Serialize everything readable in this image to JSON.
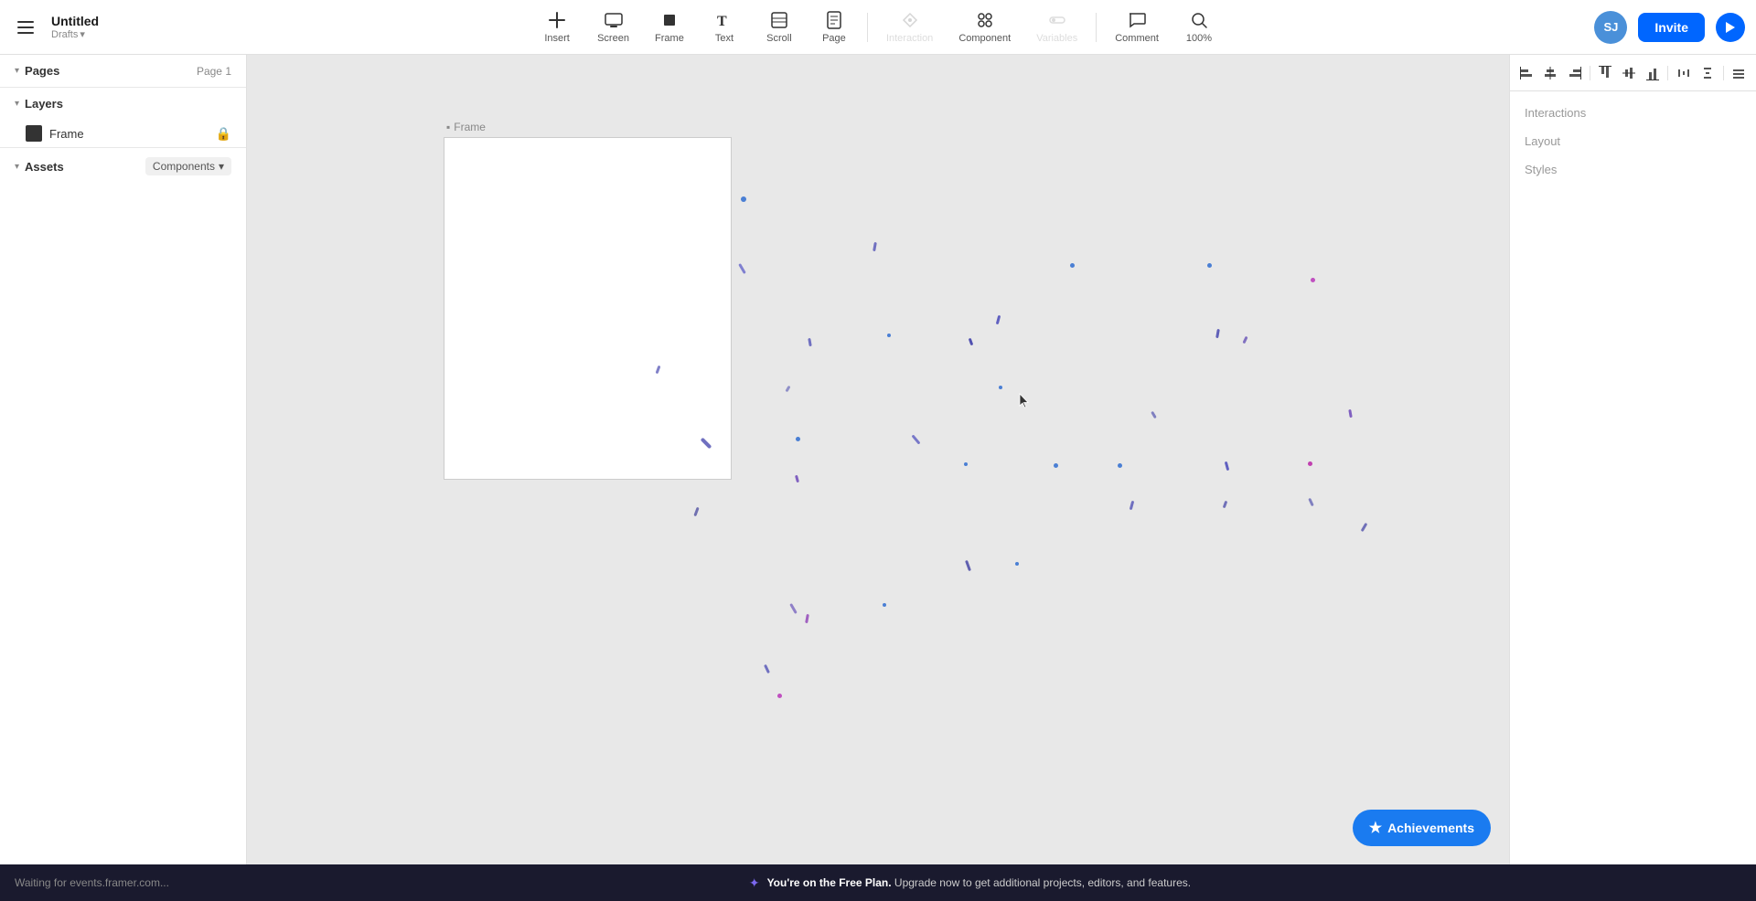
{
  "toolbar": {
    "hamburger_label": "menu",
    "project_title": "Untitled",
    "project_sub": "Drafts",
    "tools": [
      {
        "id": "insert",
        "label": "Insert",
        "icon": "+",
        "disabled": false
      },
      {
        "id": "screen",
        "label": "Screen",
        "icon": "screen",
        "disabled": false
      },
      {
        "id": "frame",
        "label": "Frame",
        "icon": "frame",
        "disabled": false
      },
      {
        "id": "text",
        "label": "Text",
        "icon": "text",
        "disabled": false
      },
      {
        "id": "scroll",
        "label": "Scroll",
        "icon": "scroll",
        "disabled": false
      },
      {
        "id": "page",
        "label": "Page",
        "icon": "page",
        "disabled": false
      },
      {
        "id": "interaction",
        "label": "Interaction",
        "icon": "interaction",
        "disabled": true
      },
      {
        "id": "component",
        "label": "Component",
        "icon": "component",
        "disabled": false
      },
      {
        "id": "variables",
        "label": "Variables",
        "icon": "variables",
        "disabled": true
      },
      {
        "id": "comment",
        "label": "Comment",
        "icon": "comment",
        "disabled": false
      },
      {
        "id": "zoom",
        "label": "100%",
        "icon": "zoom",
        "disabled": false
      }
    ],
    "avatar_initials": "SJ",
    "invite_label": "Invite"
  },
  "left_sidebar": {
    "pages_section": {
      "title": "Pages",
      "page_label": "Page 1"
    },
    "layers_section": {
      "title": "Layers",
      "items": [
        {
          "id": "frame-layer",
          "label": "Frame",
          "locked": true
        }
      ]
    },
    "assets_section": {
      "title": "Assets",
      "dropdown_label": "Components",
      "dropdown_icon": "▾"
    }
  },
  "canvas": {
    "frame_label": "Frame",
    "frame_icon": "▪"
  },
  "right_sidebar": {
    "interactions_label": "Interactions",
    "layout_label": "Layout",
    "styles_label": "Styles"
  },
  "align_toolbar": {
    "buttons": [
      "align-left",
      "align-center-h",
      "align-right",
      "align-top",
      "align-center-v",
      "align-bottom",
      "distribute-h",
      "distribute-v",
      "more"
    ]
  },
  "achievements": {
    "label": "Achievements",
    "icon": "★"
  },
  "status_bar": {
    "left_text": "Waiting for events.framer.com...",
    "upgrade_bold": "You're on the Free Plan.",
    "upgrade_text": " Upgrade now to get additional projects, editors, and features."
  }
}
